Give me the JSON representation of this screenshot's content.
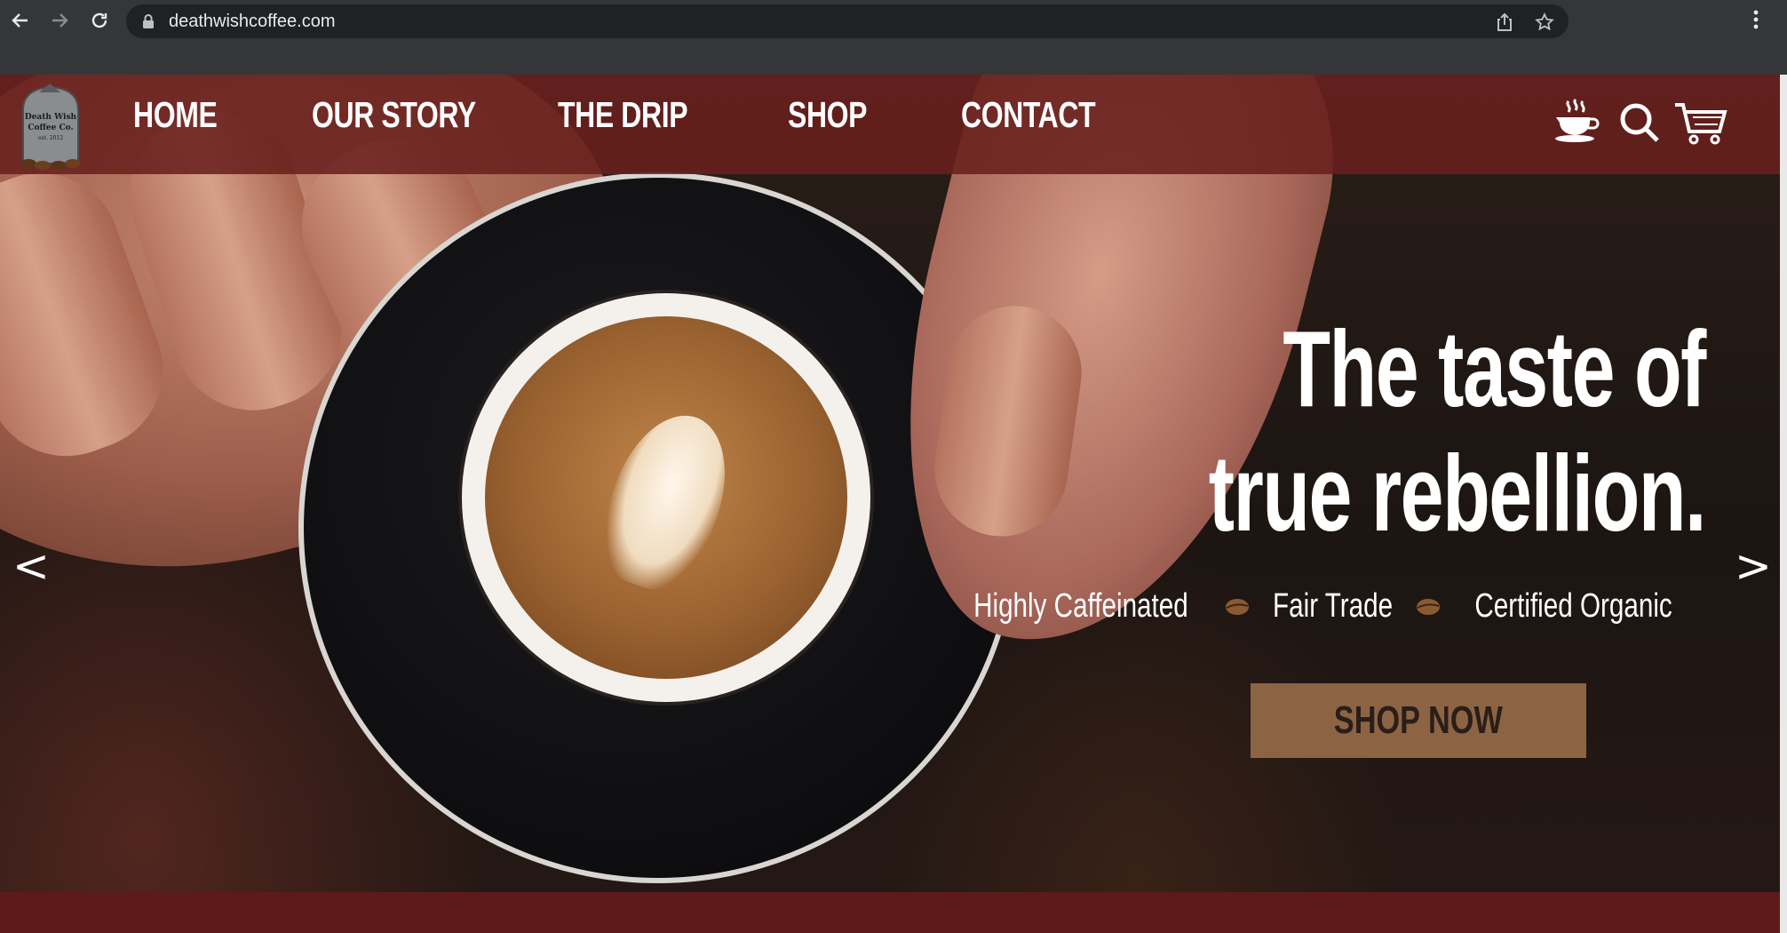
{
  "browser": {
    "url": "deathwishcoffee.com",
    "icons": [
      "back-arrow-icon",
      "forward-arrow-icon",
      "reload-icon",
      "lock-icon",
      "share-icon",
      "bookmark-star-icon",
      "kebab-menu-icon"
    ]
  },
  "site": {
    "logo_lines": [
      "Death Wish",
      "Coffee Co.",
      "est. 2012"
    ],
    "nav": [
      {
        "label": "HOME"
      },
      {
        "label": "OUR STORY"
      },
      {
        "label": "THE DRIP"
      },
      {
        "label": "SHOP"
      },
      {
        "label": "CONTACT"
      }
    ],
    "header_icons": [
      "coffee-cup-icon",
      "search-icon",
      "cart-icon"
    ],
    "colors": {
      "header_bg": "#69201e",
      "button_bg": "#8c6444",
      "bottom_band": "#5e1a1b"
    }
  },
  "hero": {
    "headline_line1": "The taste of",
    "headline_line2": "true rebellion.",
    "features": [
      "Highly Caffeinated",
      "Fair Trade",
      "Certified Organic"
    ],
    "cta_label": "SHOP NOW",
    "prev_arrow": "<",
    "next_arrow": ">"
  }
}
